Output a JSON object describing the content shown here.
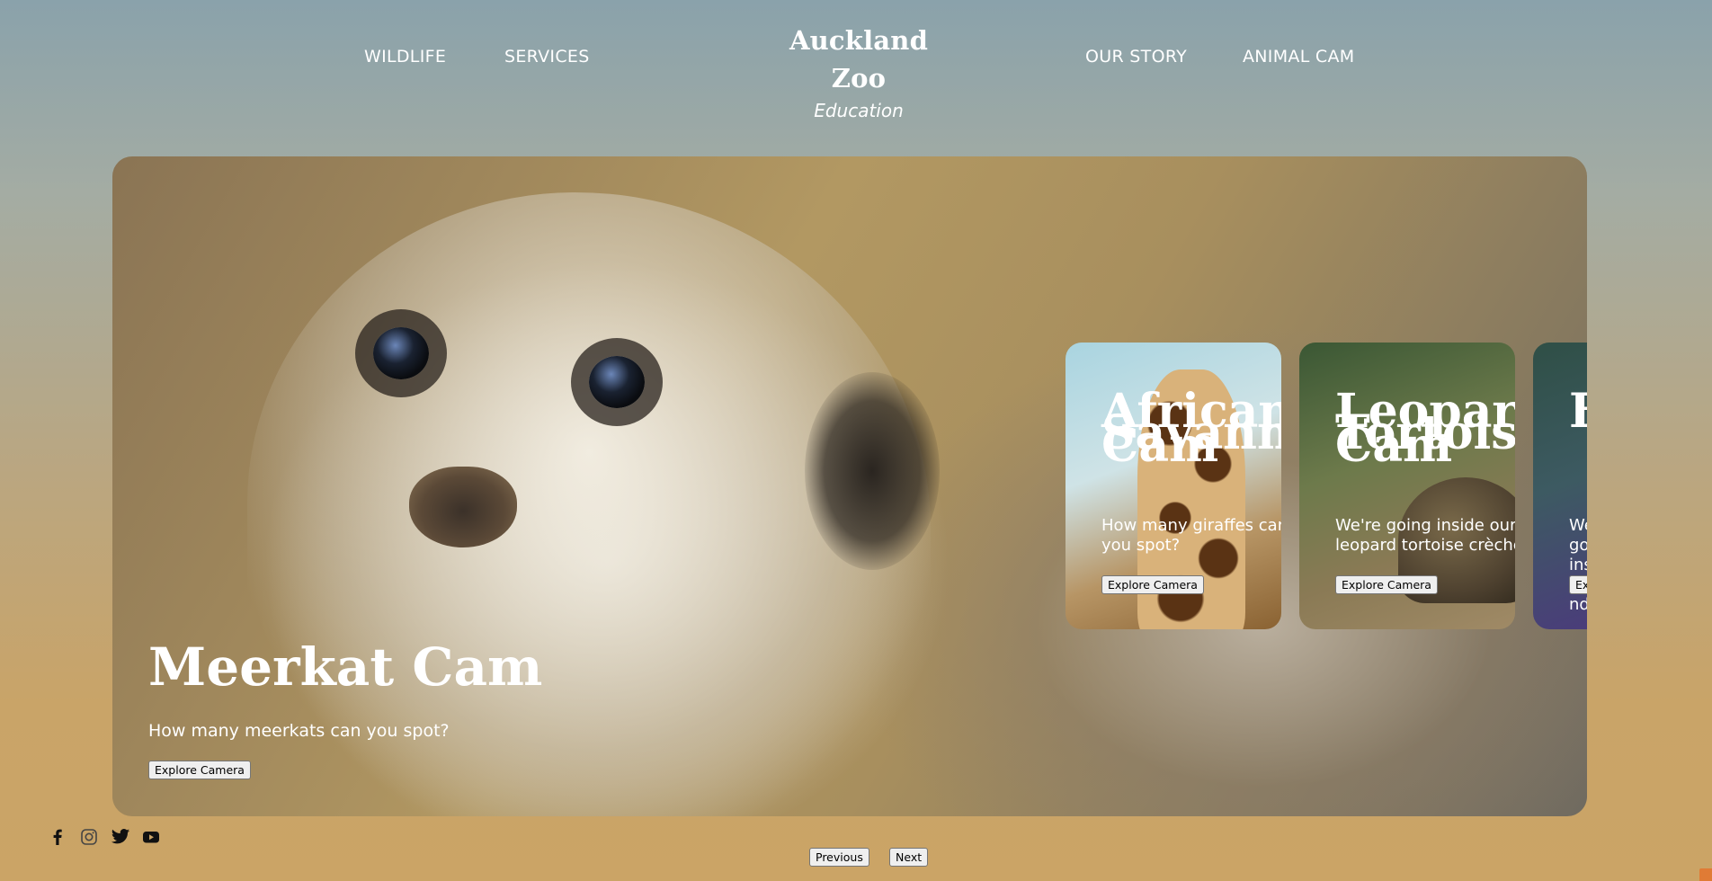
{
  "nav": {
    "left": [
      {
        "label": "WILDLIFE"
      },
      {
        "label": "SERVICES"
      }
    ],
    "right": [
      {
        "label": "OUR STORY"
      },
      {
        "label": "ANIMAL CAM"
      }
    ]
  },
  "brand": {
    "title": "Auckland Zoo",
    "subtitle": "Education"
  },
  "hero": {
    "title": "Meerkat Cam",
    "description": "How many meerkats can you spot?",
    "button_label": "Explore Camera"
  },
  "cards": [
    {
      "title_line1": "African",
      "title_line1_overlap": "Savanna",
      "title_line2": "Cam",
      "description": "How many giraffes can you spot?",
      "button_label": "Explore Camera"
    },
    {
      "title_line1": "Leopard",
      "title_line1_overlap": "Tortoise",
      "title_line2": "Cam",
      "description": "We're going inside our leopard tortoise crèche",
      "button_label": "Explore Camera"
    },
    {
      "title_line1": "E",
      "title_line1_overlap": "",
      "title_line2": "",
      "description": "We're going inside Zealand eel",
      "button_label": "Explore Camera"
    }
  ],
  "social": [
    {
      "icon": "facebook-icon"
    },
    {
      "icon": "instagram-icon"
    },
    {
      "icon": "twitter-icon"
    },
    {
      "icon": "youtube-icon"
    }
  ],
  "pager": {
    "previous_label": "Previous",
    "next_label": "Next"
  },
  "colors": {
    "background_top": "#8aa2ab",
    "background_bottom": "#cba466",
    "text": "#ffffff"
  }
}
